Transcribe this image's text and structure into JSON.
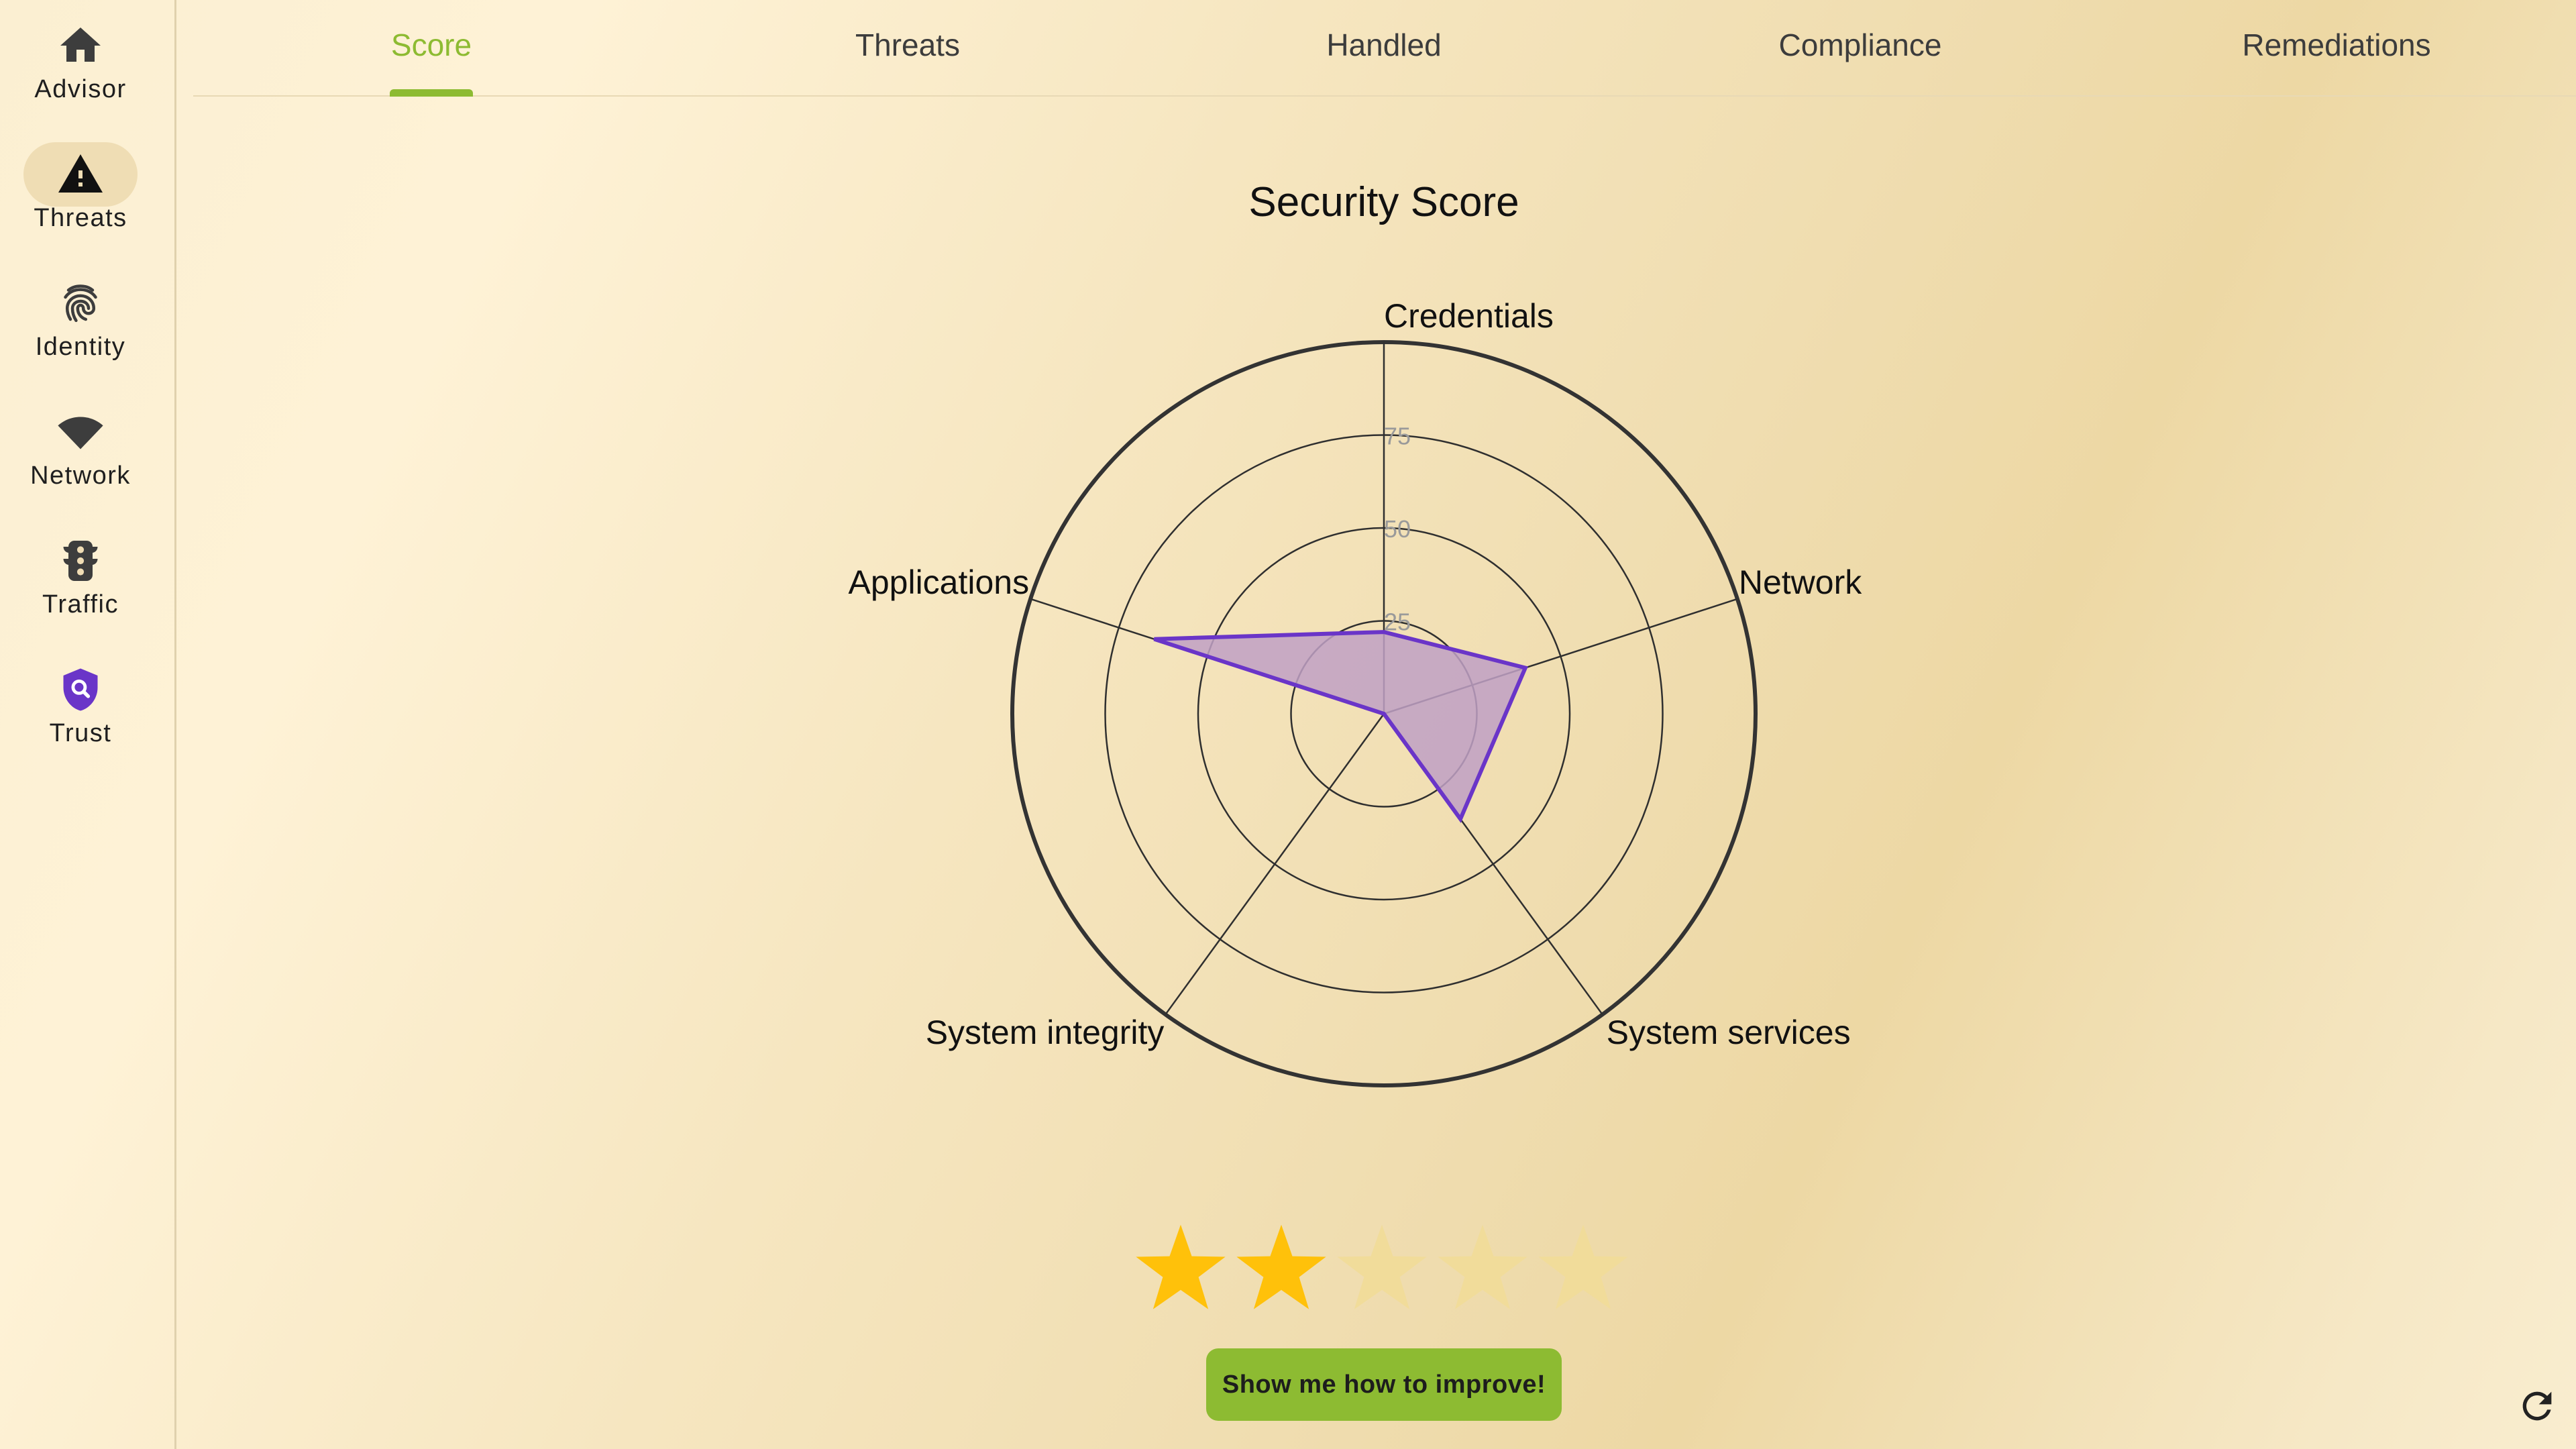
{
  "sidebar": {
    "items": [
      {
        "label": "Advisor",
        "icon": "home-icon"
      },
      {
        "label": "Threats",
        "icon": "warning-icon",
        "active": true
      },
      {
        "label": "Identity",
        "icon": "fingerprint-icon"
      },
      {
        "label": "Network",
        "icon": "wifi-icon"
      },
      {
        "label": "Traffic",
        "icon": "traffic-light-icon"
      },
      {
        "label": "Trust",
        "icon": "shield-search-icon"
      }
    ]
  },
  "tabs": [
    {
      "label": "Score",
      "active": true
    },
    {
      "label": "Threats"
    },
    {
      "label": "Handled"
    },
    {
      "label": "Compliance"
    },
    {
      "label": "Remediations"
    }
  ],
  "chart_data": {
    "type": "radar",
    "title": "Security Score",
    "axes": [
      "Credentials",
      "Network",
      "System services",
      "System integrity",
      "Applications"
    ],
    "ticks": [
      "25",
      "50",
      "75"
    ],
    "range": [
      0,
      100
    ],
    "series": [
      {
        "values": [
          22,
          40,
          35,
          0,
          65
        ]
      }
    ],
    "fill_color": "#bfa0c4",
    "line_color": "#6a35c8"
  },
  "rating": {
    "value": 2,
    "max": 5,
    "filled_color": "#ffc10a",
    "empty_color": "#f1dc9a"
  },
  "improve_button": {
    "label": "Show me how to improve!"
  },
  "refresh": {
    "icon": "refresh-icon"
  },
  "colors": {
    "accent": "#8dbb32",
    "trust_icon": "#6a35c8"
  }
}
